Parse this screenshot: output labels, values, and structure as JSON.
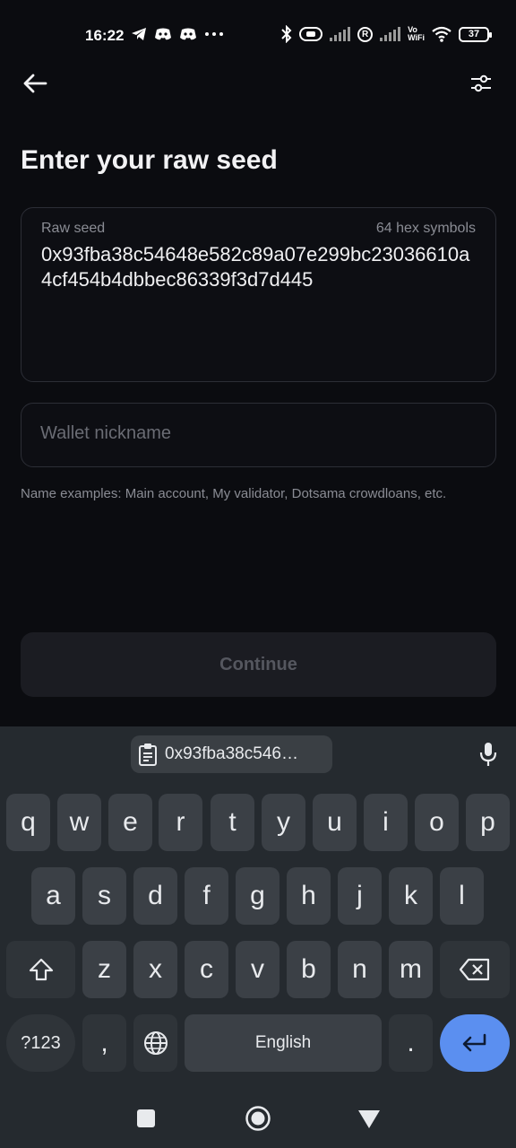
{
  "status_bar": {
    "time": "16:22",
    "left_icons": [
      "telegram-icon",
      "discord-icon",
      "discord-icon",
      "more-dots-icon"
    ],
    "right_icons": [
      "bluetooth-icon",
      "battery-saver-icon",
      "signal-icon",
      "roaming-icon",
      "signal-icon",
      "vowifi-icon",
      "wifi-icon",
      "battery-icon"
    ],
    "roaming": "R",
    "vowifi": "Vo\nWiFi",
    "battery": "37"
  },
  "header": {
    "back_icon": "arrow-left-icon",
    "settings_icon": "sliders-icon"
  },
  "page": {
    "title": "Enter your raw seed",
    "seed": {
      "label": "Raw seed",
      "hint": "64 hex symbols",
      "value": "0x93fba38c54648e582c89a07e299bc23036610a4cf454b4dbbec86339f3d7d445"
    },
    "nickname": {
      "placeholder": "Wallet nickname",
      "value": ""
    },
    "helper": "Name examples: Main account, My validator, Dotsama crowdloans, etc.",
    "continue_label": "Continue"
  },
  "keyboard": {
    "clipboard_text": "0x93fba38c546…",
    "row1": [
      "q",
      "w",
      "e",
      "r",
      "t",
      "y",
      "u",
      "i",
      "o",
      "p"
    ],
    "row2": [
      "a",
      "s",
      "d",
      "f",
      "g",
      "h",
      "j",
      "k",
      "l"
    ],
    "row3": [
      "z",
      "x",
      "c",
      "v",
      "b",
      "n",
      "m"
    ],
    "symbols_label": "?123",
    "comma": ",",
    "space_label": "English",
    "period": "."
  },
  "colors": {
    "background": "#0b0c10",
    "keyboard": "#252a2f",
    "enter_key": "#5b8ff0"
  }
}
